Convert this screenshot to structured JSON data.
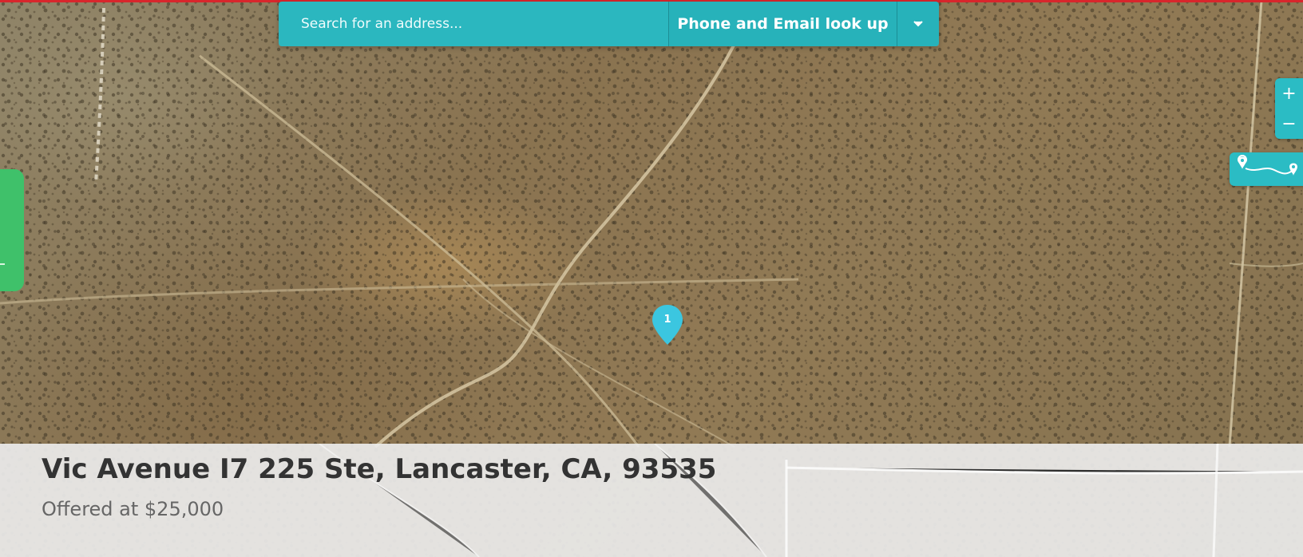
{
  "search": {
    "placeholder": "Search for an address...",
    "lookup_label": "Phone and Email look up"
  },
  "map_controls": {
    "zoom_in": "+",
    "zoom_out": "−"
  },
  "marker": {
    "label": "1"
  },
  "listing": {
    "address": "Vic Avenue I7 225 Ste, Lancaster, CA, 93535",
    "price": "Offered at $25,000"
  },
  "colors": {
    "accent_teal": "#2bb7bf",
    "brand_red": "#d8262c",
    "green_tab": "#3fc16a",
    "marker": "#3bc6e0"
  },
  "icons": {
    "dropdown": "chevron-down-icon",
    "route": "route-icon",
    "marker": "map-pin-icon"
  }
}
